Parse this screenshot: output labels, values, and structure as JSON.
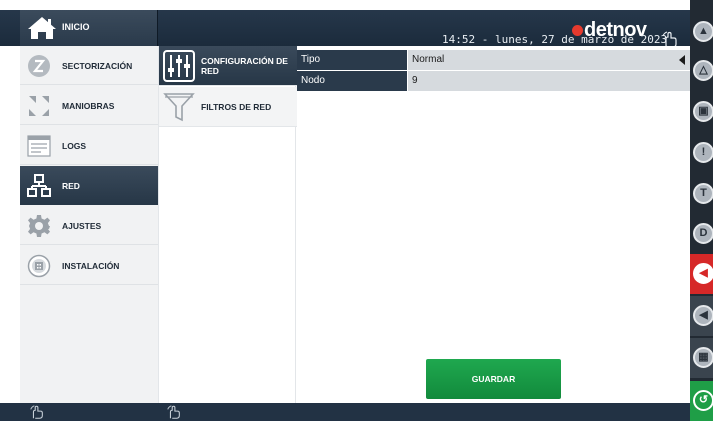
{
  "header": {
    "home_label": "INICIO",
    "brand": "detnov",
    "datetime": "14:52  -  lunes, 27 de marzo de 2023",
    "colors": {
      "brand_dot": "#e63a2e",
      "bar": "#1f2f40"
    }
  },
  "menu": {
    "items": [
      {
        "label": "SECTORIZACIÓN",
        "icon": "sector-icon",
        "active": false
      },
      {
        "label": "MANIOBRAS",
        "icon": "maneuvers-icon",
        "active": false
      },
      {
        "label": "LOGS",
        "icon": "logs-icon",
        "active": false
      },
      {
        "label": "RED",
        "icon": "network-icon",
        "active": true
      },
      {
        "label": "AJUSTES",
        "icon": "gear-icon",
        "active": false
      },
      {
        "label": "INSTALACIÓN",
        "icon": "building-icon",
        "active": false
      }
    ]
  },
  "submenu": {
    "items": [
      {
        "label": "CONFIGURACIÓN DE RED",
        "icon": "sliders-icon",
        "active": true
      },
      {
        "label": "FILTROS DE RED",
        "icon": "filter-icon",
        "active": false
      }
    ]
  },
  "content": {
    "rows": [
      {
        "key": "Tipo",
        "value": "Normal",
        "dropdown": true
      },
      {
        "key": "Nodo",
        "value": "9",
        "dropdown": false
      }
    ],
    "save_label": "GUARDAR"
  },
  "right_panel": {
    "buttons": [
      "fire-icon",
      "warning-icon",
      "lock-icon",
      "alert-icon",
      "test-icon",
      "disabled-icon",
      "siren-icon",
      "horn-icon",
      "relay-icon",
      "reset-icon"
    ],
    "letters": {
      "test": "T",
      "disabled": "D",
      "alert": "!"
    },
    "colors": {
      "siren_bg": "#d62828",
      "reset_bg": "#1f9e47"
    }
  }
}
